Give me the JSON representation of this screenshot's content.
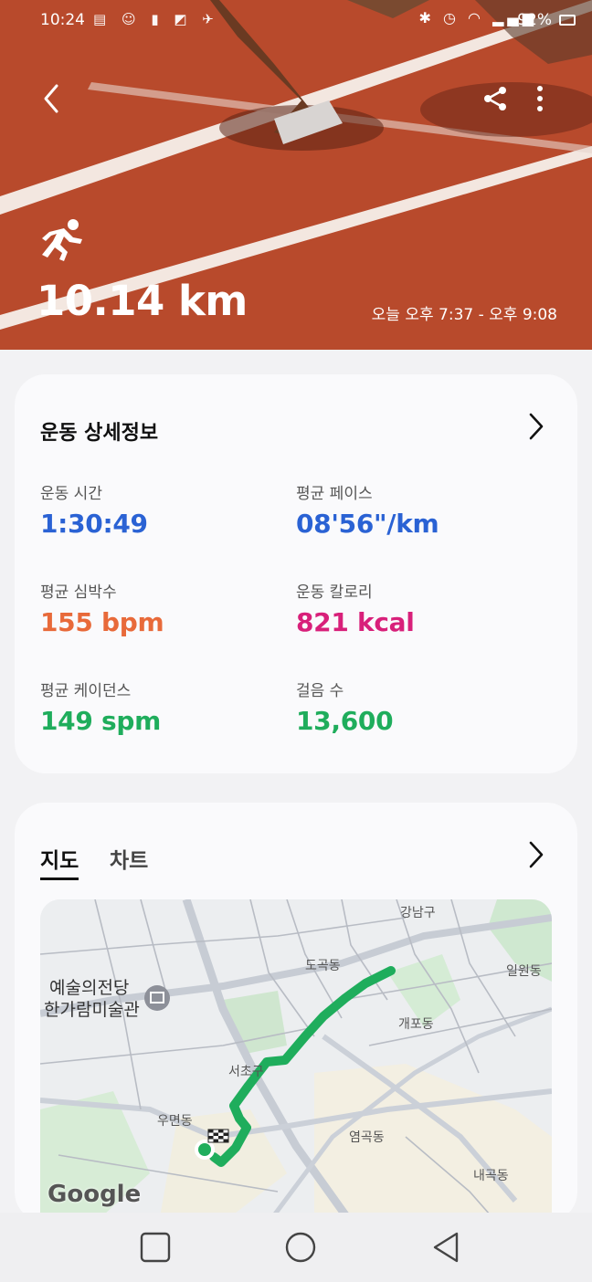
{
  "status_bar": {
    "time": "10:24",
    "left_icons": [
      "mbc-radio-icon",
      "person-icon",
      "battery-saver-icon",
      "app-icon",
      "app2-icon"
    ],
    "right_icons": [
      "bluetooth-icon",
      "alarm-icon",
      "wifi-icon",
      "signal-icon"
    ],
    "battery": "92%"
  },
  "hero": {
    "distance": "10.14 km",
    "time_range": "오늘 오후 7:37 - 오후 9:08",
    "track_color": "#b84a2c"
  },
  "details": {
    "title": "운동 상세정보",
    "metrics": [
      {
        "label": "운동 시간",
        "value": "1:30:49",
        "color": "#2a62d4"
      },
      {
        "label": "평균 페이스",
        "value": "08'56\"/km",
        "color": "#2a62d4"
      },
      {
        "label": "평균 심박수",
        "value": "155 bpm",
        "color": "#e86a3a"
      },
      {
        "label": "운동 칼로리",
        "value": "821 kcal",
        "color": "#d8207a"
      },
      {
        "label": "평균 케이던스",
        "value": "149 spm",
        "color": "#1fad5c"
      },
      {
        "label": "걸음 수",
        "value": "13,600",
        "color": "#1fad5c"
      }
    ]
  },
  "map_section": {
    "tabs": [
      "지도",
      "차트"
    ],
    "active_tab": "지도",
    "labels": {
      "gangnam": "강남구",
      "dogok": "도곡동",
      "ilwon": "일원동",
      "gaepo": "개포동",
      "seocho": "서초구",
      "umyeon": "우면동",
      "yeomgok": "염곡동",
      "naegok": "내곡동",
      "arts_center": "예술의전당",
      "museum": "한가람미술관"
    },
    "attribution": "Google",
    "route_color": "#1fad5c"
  }
}
